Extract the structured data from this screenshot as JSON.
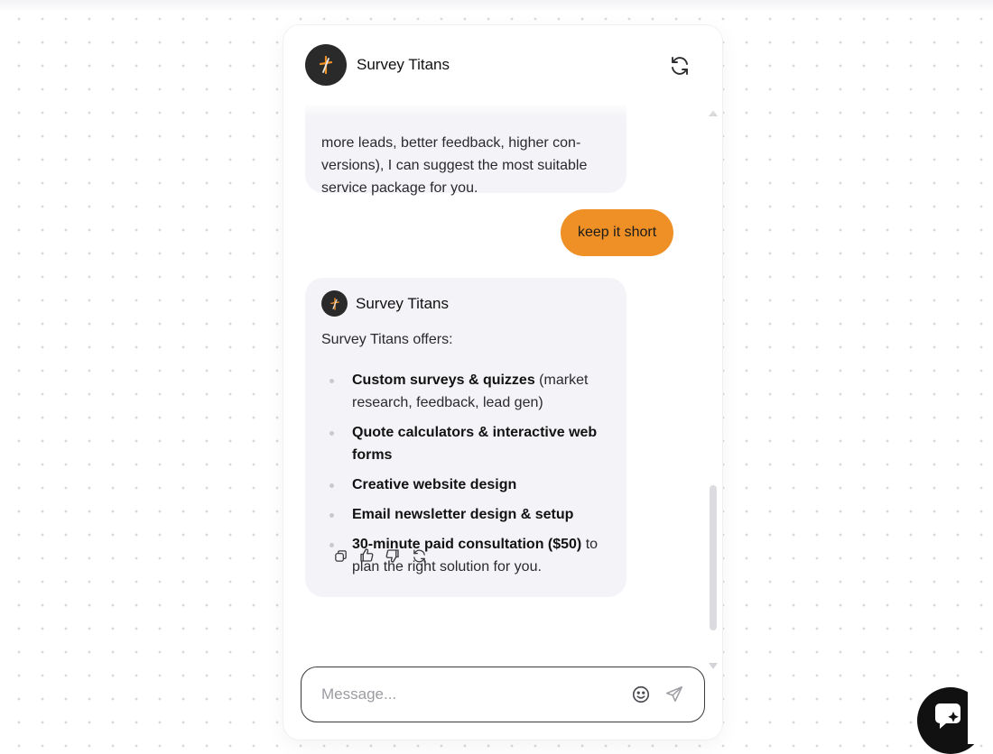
{
  "header": {
    "title": "Survey Titans",
    "avatar_icon": "survey-titans-logo-icon",
    "refresh_icon": "refresh-icon"
  },
  "messages": {
    "bot_partial": {
      "lines": [
        "more leads, better feedback, higher con-",
        "versions), I can suggest the most suitable",
        "service package for you."
      ]
    },
    "user": {
      "text": "keep it short"
    },
    "bot_reply": {
      "sender": "Survey Titans",
      "intro": "Survey Titans offers:",
      "items": [
        {
          "bold": "Custom surveys & quizzes",
          "rest": " (market research, feedback, lead gen)"
        },
        {
          "bold": "Quote calculators & interactive web forms",
          "rest": ""
        },
        {
          "bold": "Creative website design",
          "rest": ""
        },
        {
          "bold": "Email newsletter design & setup",
          "rest": ""
        },
        {
          "bold": "30-minute paid consultation ($50)",
          "rest": " to plan the right solution for you."
        }
      ],
      "actions": [
        "copy-icon",
        "thumbs-up-icon",
        "thumbs-down-icon",
        "regenerate-icon"
      ]
    }
  },
  "composer": {
    "placeholder": "Message...",
    "value": "",
    "emoji_icon": "emoji-icon",
    "send_icon": "send-icon"
  },
  "launcher": {
    "icon": "chat-sparkle-icon"
  },
  "colors": {
    "accent_orange": "#ef9026",
    "bot_bubble": "#f4f3f7",
    "avatar_dark": "#2a2a2a",
    "launcher": "#111111"
  }
}
